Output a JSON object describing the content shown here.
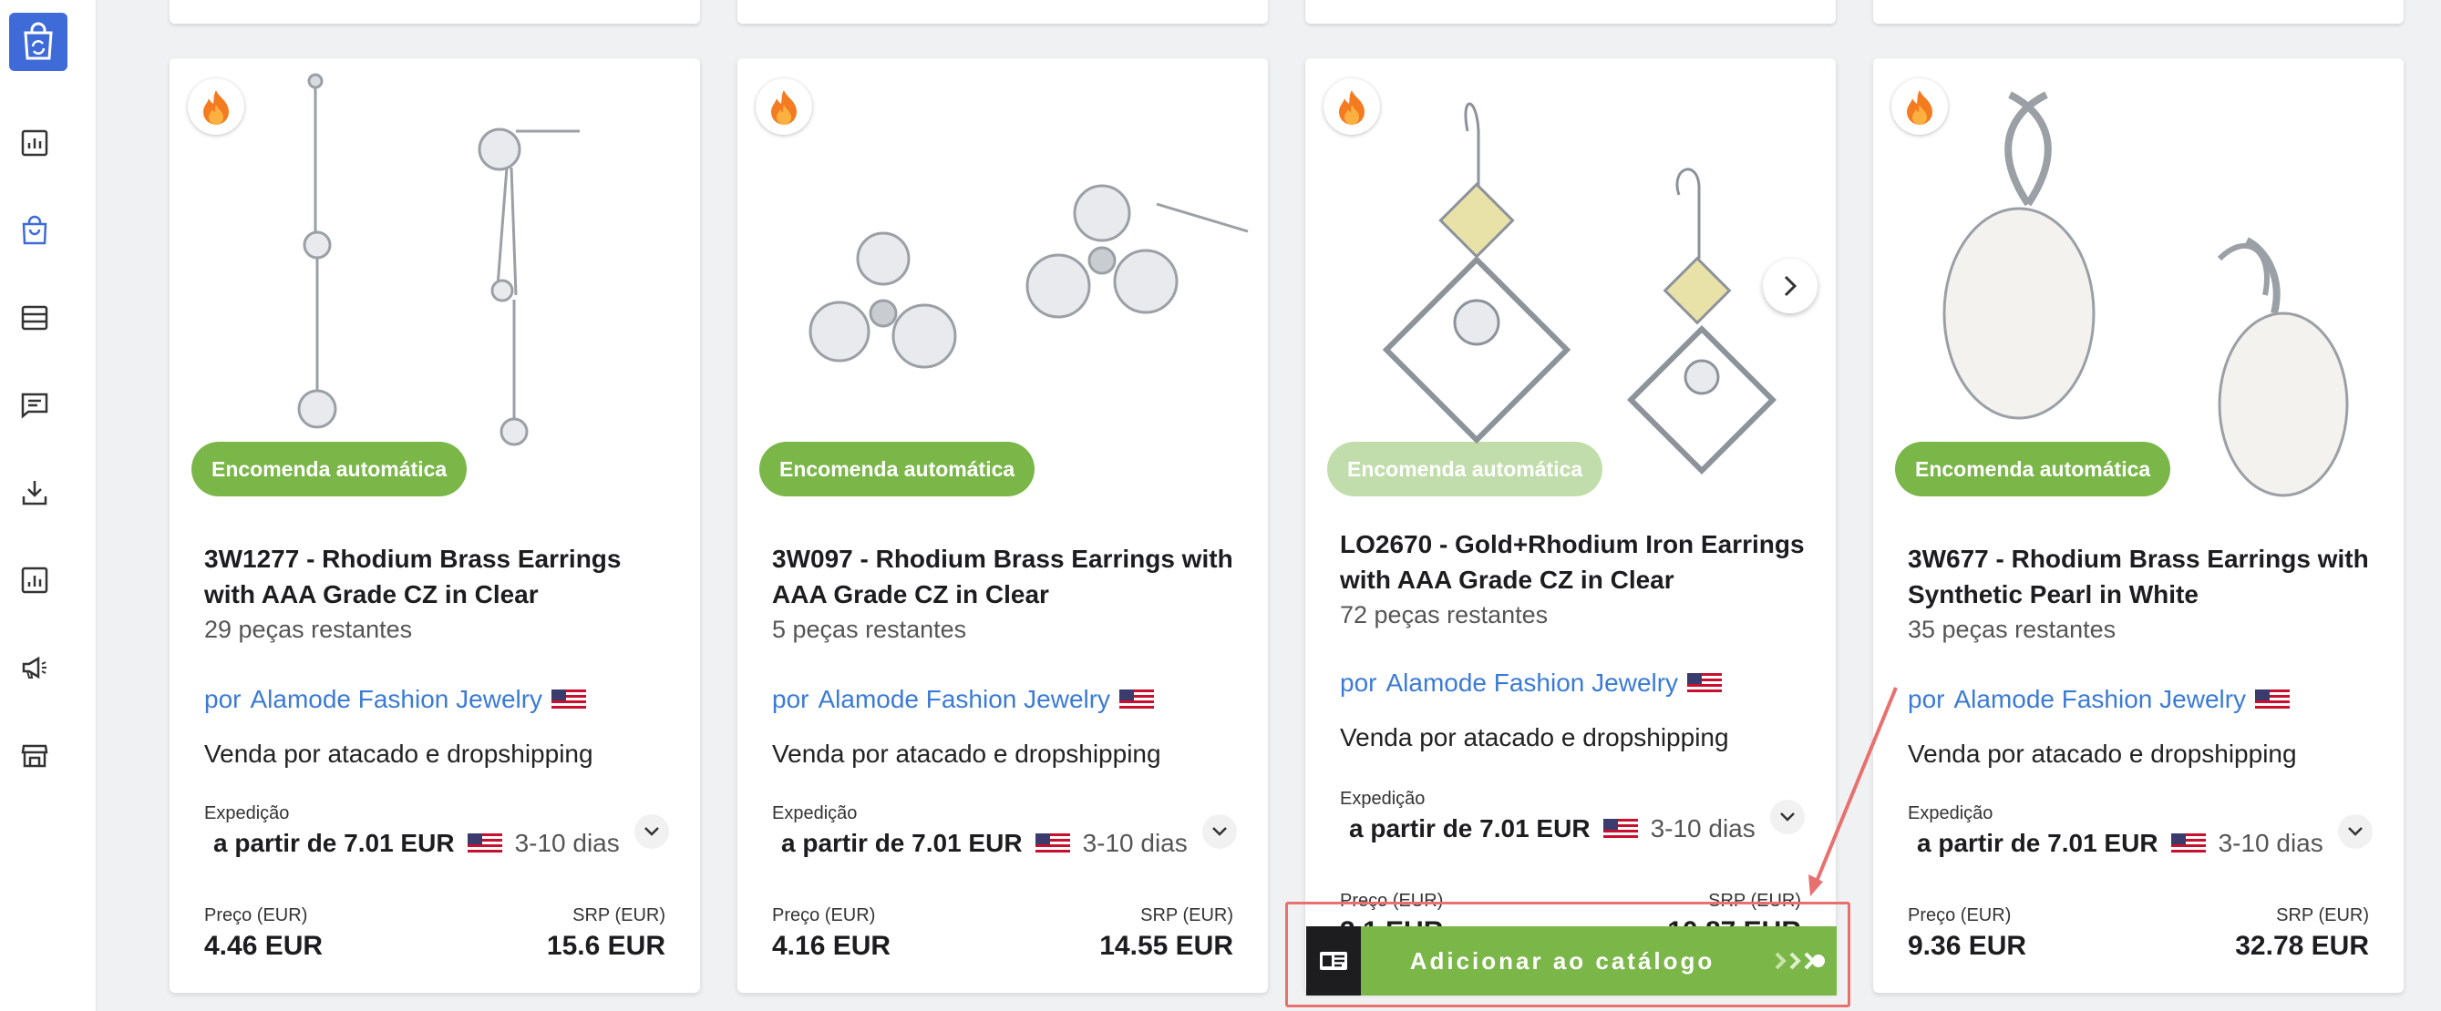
{
  "colors": {
    "accent": "#3f6bd8",
    "badge_green": "#7ab648",
    "link_blue": "#3a7bd5",
    "highlight_red": "#e8716f"
  },
  "sidebar": {
    "items": [
      {
        "icon": "bar-chart-icon"
      },
      {
        "icon": "shopping-bag-icon"
      },
      {
        "icon": "list-icon"
      },
      {
        "icon": "message-icon"
      },
      {
        "icon": "download-icon"
      },
      {
        "icon": "report-icon"
      },
      {
        "icon": "megaphone-icon"
      },
      {
        "icon": "store-icon"
      }
    ]
  },
  "products": [
    {
      "badge": "Encomenda automática",
      "title": "3W1277 - Rhodium Brass Earrings with AAA Grade CZ in Clear",
      "remaining": "29 peças restantes",
      "por": "por",
      "seller": "Alamode Fashion Jewelry",
      "wholesale": "Venda por atacado e dropshipping",
      "ship_label": "Expedição",
      "ship_price": "a partir de 7.01 EUR",
      "ship_days": "3-10 dias",
      "price_label": "Preço (EUR)",
      "price": "4.46 EUR",
      "srp_label": "SRP (EUR)",
      "srp": "15.6 EUR"
    },
    {
      "badge": "Encomenda automática",
      "title": "3W097 - Rhodium Brass Earrings with AAA Grade CZ in Clear",
      "remaining": "5 peças restantes",
      "por": "por",
      "seller": "Alamode Fashion Jewelry",
      "wholesale": "Venda por atacado e dropshipping",
      "ship_label": "Expedição",
      "ship_price": "a partir de 7.01 EUR",
      "ship_days": "3-10 dias",
      "price_label": "Preço (EUR)",
      "price": "4.16 EUR",
      "srp_label": "SRP (EUR)",
      "srp": "14.55 EUR"
    },
    {
      "badge": "Encomenda automática",
      "title": "LO2670 - Gold+Rhodium Iron Earrings with AAA Grade CZ in Clear",
      "remaining": "72 peças restantes",
      "por": "por",
      "seller": "Alamode Fashion Jewelry",
      "wholesale": "Venda por atacado e dropshipping",
      "ship_label": "Expedição",
      "ship_price": "a partir de 7.01 EUR",
      "ship_days": "3-10 dias",
      "price_label": "Preço (EUR)",
      "price": "3.1 EUR",
      "srp_label": "SRP (EUR)",
      "srp": "10.87 EUR",
      "add_button": "Adicionar ao catálogo"
    },
    {
      "badge": "Encomenda automática",
      "title": "3W677 - Rhodium Brass Earrings with Synthetic Pearl in White",
      "remaining": "35 peças restantes",
      "por": "por",
      "seller": "Alamode Fashion Jewelry",
      "wholesale": "Venda por atacado e dropshipping",
      "ship_label": "Expedição",
      "ship_price": "a partir de 7.01 EUR",
      "ship_days": "3-10 dias",
      "price_label": "Preço (EUR)",
      "price": "9.36 EUR",
      "srp_label": "SRP (EUR)",
      "srp": "32.78 EUR"
    }
  ]
}
